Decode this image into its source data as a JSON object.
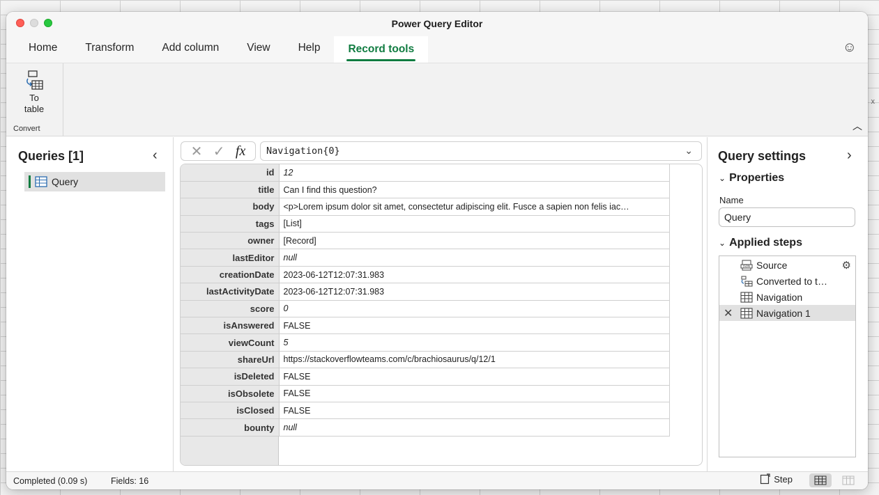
{
  "window": {
    "title": "Power Query Editor"
  },
  "tabs": [
    {
      "label": "Home",
      "active": false
    },
    {
      "label": "Transform",
      "active": false
    },
    {
      "label": "Add column",
      "active": false
    },
    {
      "label": "View",
      "active": false
    },
    {
      "label": "Help",
      "active": false
    },
    {
      "label": "Record tools",
      "active": true
    }
  ],
  "ribbon": {
    "to_table_label": "To table",
    "group_label": "Convert"
  },
  "queries": {
    "title": "Queries [1]",
    "items": [
      {
        "label": "Query"
      }
    ]
  },
  "formula": {
    "text": "Navigation{0}"
  },
  "record": [
    {
      "key": "id",
      "value": "12",
      "style": "italic"
    },
    {
      "key": "title",
      "value": "Can I find this question?",
      "style": "normal"
    },
    {
      "key": "body",
      "value": "<p>Lorem ipsum dolor sit amet, consectetur adipiscing elit. Fusce a sapien non felis iac…",
      "style": "normal"
    },
    {
      "key": "tags",
      "value": "[List]",
      "style": "link"
    },
    {
      "key": "owner",
      "value": "[Record]",
      "style": "link"
    },
    {
      "key": "lastEditor",
      "value": "null",
      "style": "italic"
    },
    {
      "key": "creationDate",
      "value": "2023-06-12T12:07:31.983",
      "style": "normal"
    },
    {
      "key": "lastActivityDate",
      "value": "2023-06-12T12:07:31.983",
      "style": "normal"
    },
    {
      "key": "score",
      "value": "0",
      "style": "italic"
    },
    {
      "key": "isAnswered",
      "value": "FALSE",
      "style": "normal"
    },
    {
      "key": "viewCount",
      "value": "5",
      "style": "italic"
    },
    {
      "key": "shareUrl",
      "value": "https://stackoverflowteams.com/c/brachiosaurus/q/12/1",
      "style": "normal"
    },
    {
      "key": "isDeleted",
      "value": "FALSE",
      "style": "normal"
    },
    {
      "key": "isObsolete",
      "value": "FALSE",
      "style": "normal"
    },
    {
      "key": "isClosed",
      "value": "FALSE",
      "style": "normal"
    },
    {
      "key": "bounty",
      "value": "null",
      "style": "italic"
    }
  ],
  "settings": {
    "title": "Query settings",
    "properties_label": "Properties",
    "name_label": "Name",
    "name_value": "Query",
    "applied_steps_label": "Applied steps",
    "steps": [
      {
        "label": "Source",
        "icon": "json-source-icon",
        "selected": false,
        "has_gear": true
      },
      {
        "label": "Converted to t…",
        "icon": "convert-table-icon",
        "selected": false,
        "has_gear": false
      },
      {
        "label": "Navigation",
        "icon": "table-icon",
        "selected": false,
        "has_gear": false
      },
      {
        "label": "Navigation 1",
        "icon": "table-icon",
        "selected": true,
        "has_gear": false
      }
    ]
  },
  "status": {
    "text": "Completed (0.09 s)",
    "fields": "Fields: 16",
    "step_label": "Step"
  },
  "colors": {
    "accent": "#107c41",
    "selected_row": "#e1e1e1"
  }
}
